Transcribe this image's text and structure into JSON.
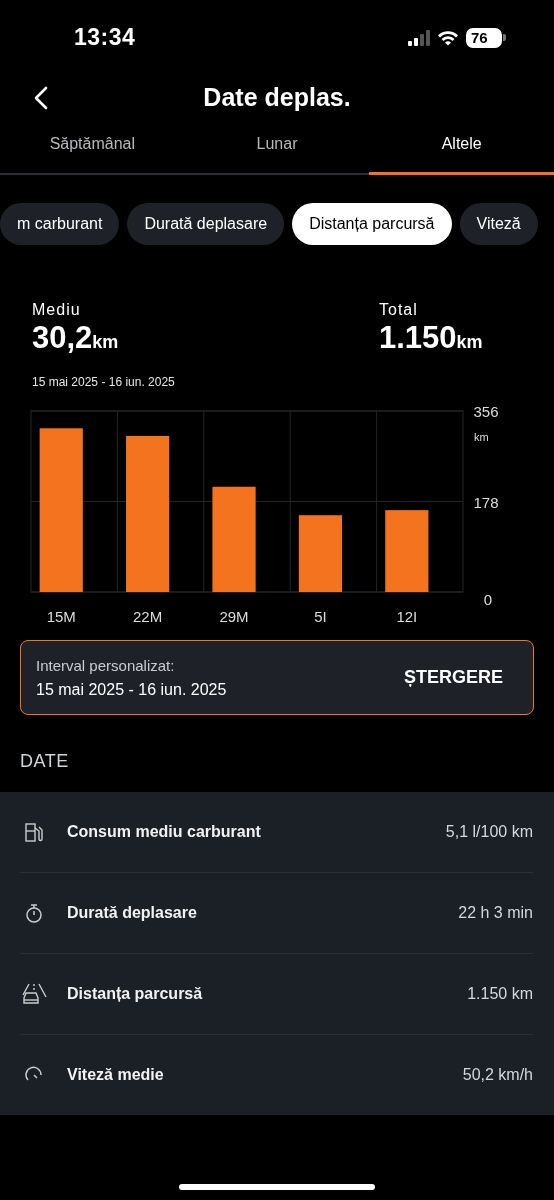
{
  "status_bar": {
    "time": "13:34",
    "battery": "76"
  },
  "header": {
    "title": "Date deplas."
  },
  "tabs": [
    {
      "label": "Săptămânal",
      "selected": false
    },
    {
      "label": "Lunar",
      "selected": false
    },
    {
      "label": "Altele",
      "selected": true
    }
  ],
  "chips": [
    {
      "label": "m carburant",
      "selected": false
    },
    {
      "label": "Durată deplasare",
      "selected": false
    },
    {
      "label": "Distanța parcursă",
      "selected": true
    },
    {
      "label": "Viteză",
      "selected": false
    }
  ],
  "summary": {
    "average_label": "Mediu",
    "average_value": "30,2",
    "average_unit": "km",
    "total_label": "Total",
    "total_value": "1.150",
    "total_unit": "km",
    "range": "15 mai 2025 - 16 iun. 2025"
  },
  "chart": {
    "unit": "km",
    "chart_data": {
      "type": "bar",
      "categories": [
        "15M",
        "22M",
        "29M",
        "5I",
        "12I"
      ],
      "series": [
        {
          "color": "#f4731e",
          "values": [
            322,
            307,
            207,
            151,
            161
          ]
        }
      ],
      "ylim": [
        0,
        356
      ],
      "yticks": [
        0,
        178,
        356
      ]
    }
  },
  "interval": {
    "label": "Interval personalizat:",
    "range": "15 mai 2025 - 16 iun. 2025",
    "action": "ȘTERGERE"
  },
  "data_section": {
    "heading": "DATE",
    "rows": [
      {
        "kind": "fuel",
        "label": "Consum mediu carburant",
        "value": "5,1 l/100 km"
      },
      {
        "kind": "timer",
        "label": "Durată deplasare",
        "value": "22 h 3 min"
      },
      {
        "kind": "road",
        "label": "Distanța parcursă",
        "value": "1.150 km"
      },
      {
        "kind": "speed",
        "label": "Viteză medie",
        "value": "50,2 km/h"
      }
    ]
  }
}
